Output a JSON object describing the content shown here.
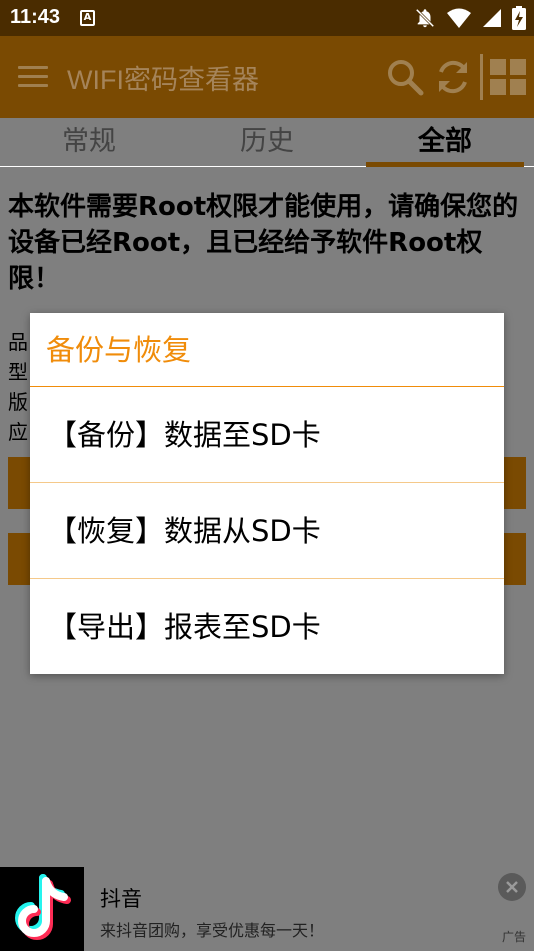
{
  "status_bar": {
    "time": "11:43",
    "notification_glyph": "A",
    "icons": [
      "notifications-off-icon",
      "wifi-icon",
      "cellular-signal-icon",
      "battery-charging-icon"
    ]
  },
  "app_bar": {
    "title": "WIFI密码查看器",
    "actions": [
      "search-icon",
      "refresh-icon",
      "grid-icon"
    ]
  },
  "tabs": [
    {
      "label": "常规",
      "active": false
    },
    {
      "label": "历史",
      "active": false
    },
    {
      "label": "全部",
      "active": true
    }
  ],
  "content": {
    "notice": "本软件需要Root权限才能使用，请确保您的设备已经Root，且已经给予软件Root权限！",
    "info_labels": [
      "品",
      "型",
      "版",
      "应"
    ]
  },
  "dialog": {
    "title": "备份与恢复",
    "items": [
      "【备份】数据至SD卡",
      "【恢复】数据从SD卡",
      "【导出】报表至SD卡"
    ]
  },
  "ad": {
    "title": "抖音",
    "subtitle": "来抖音团购，享受优惠每一天！",
    "label": "广告"
  },
  "colors": {
    "primary": "#f19300",
    "dialog_accent": "#f08c0a",
    "status_bar": "#4a2c00",
    "scrim": "#7f7f7f"
  }
}
